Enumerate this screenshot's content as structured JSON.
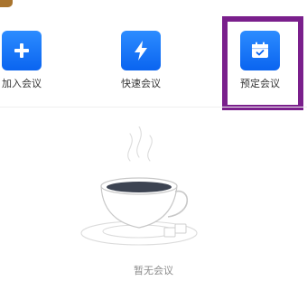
{
  "actions": [
    {
      "id": "join",
      "label": "加入会议",
      "icon": "plus-icon"
    },
    {
      "id": "quick",
      "label": "快速会议",
      "icon": "lightning-icon"
    },
    {
      "id": "schedule",
      "label": "预定会议",
      "icon": "calendar-check-icon"
    }
  ],
  "empty_state": {
    "text": "暂无会议",
    "icon": "coffee-cup-icon"
  },
  "colors": {
    "accent": "#0a64f0",
    "highlight": "#7a1f8c",
    "muted_text": "#8c8c8c"
  }
}
